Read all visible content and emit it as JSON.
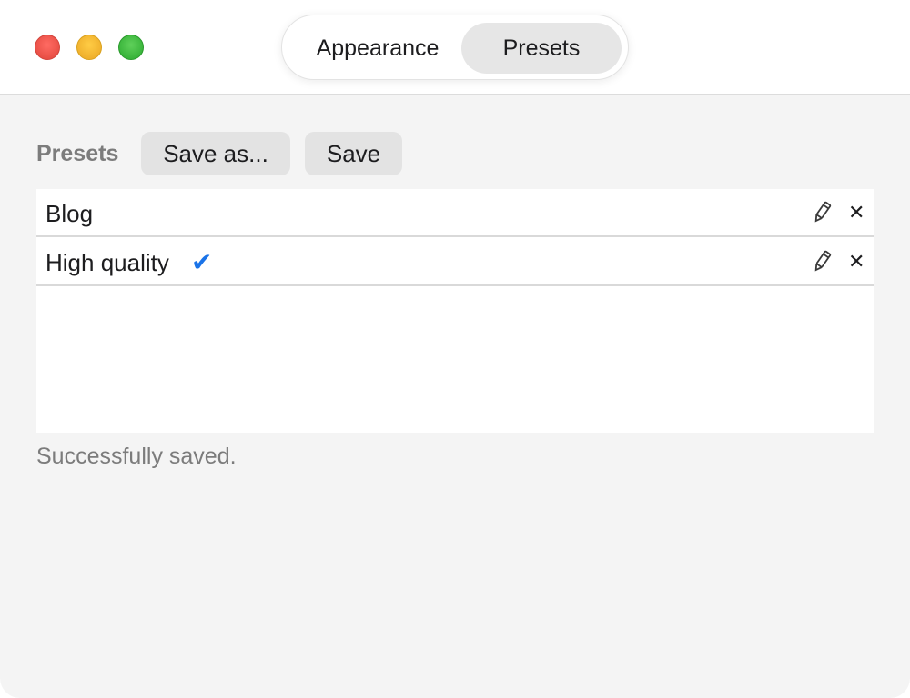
{
  "window": {
    "controls": [
      "close",
      "minimize",
      "zoom"
    ]
  },
  "tabs": [
    {
      "label": "Appearance",
      "selected": false
    },
    {
      "label": "Presets",
      "selected": true
    }
  ],
  "toolbar": {
    "section_label": "Presets",
    "save_as_label": "Save as...",
    "save_label": "Save"
  },
  "presets": [
    {
      "name": "Blog",
      "active": false
    },
    {
      "name": "High quality",
      "active": true
    }
  ],
  "icons": {
    "active": "checkmark-icon",
    "edit": "pencil-icon",
    "delete": "close-icon"
  },
  "colors": {
    "accent": "#1a73e8",
    "window_bg": "#f4f4f4",
    "secondary_text": "#7c7c7c"
  },
  "status": {
    "message": "Successfully saved."
  }
}
